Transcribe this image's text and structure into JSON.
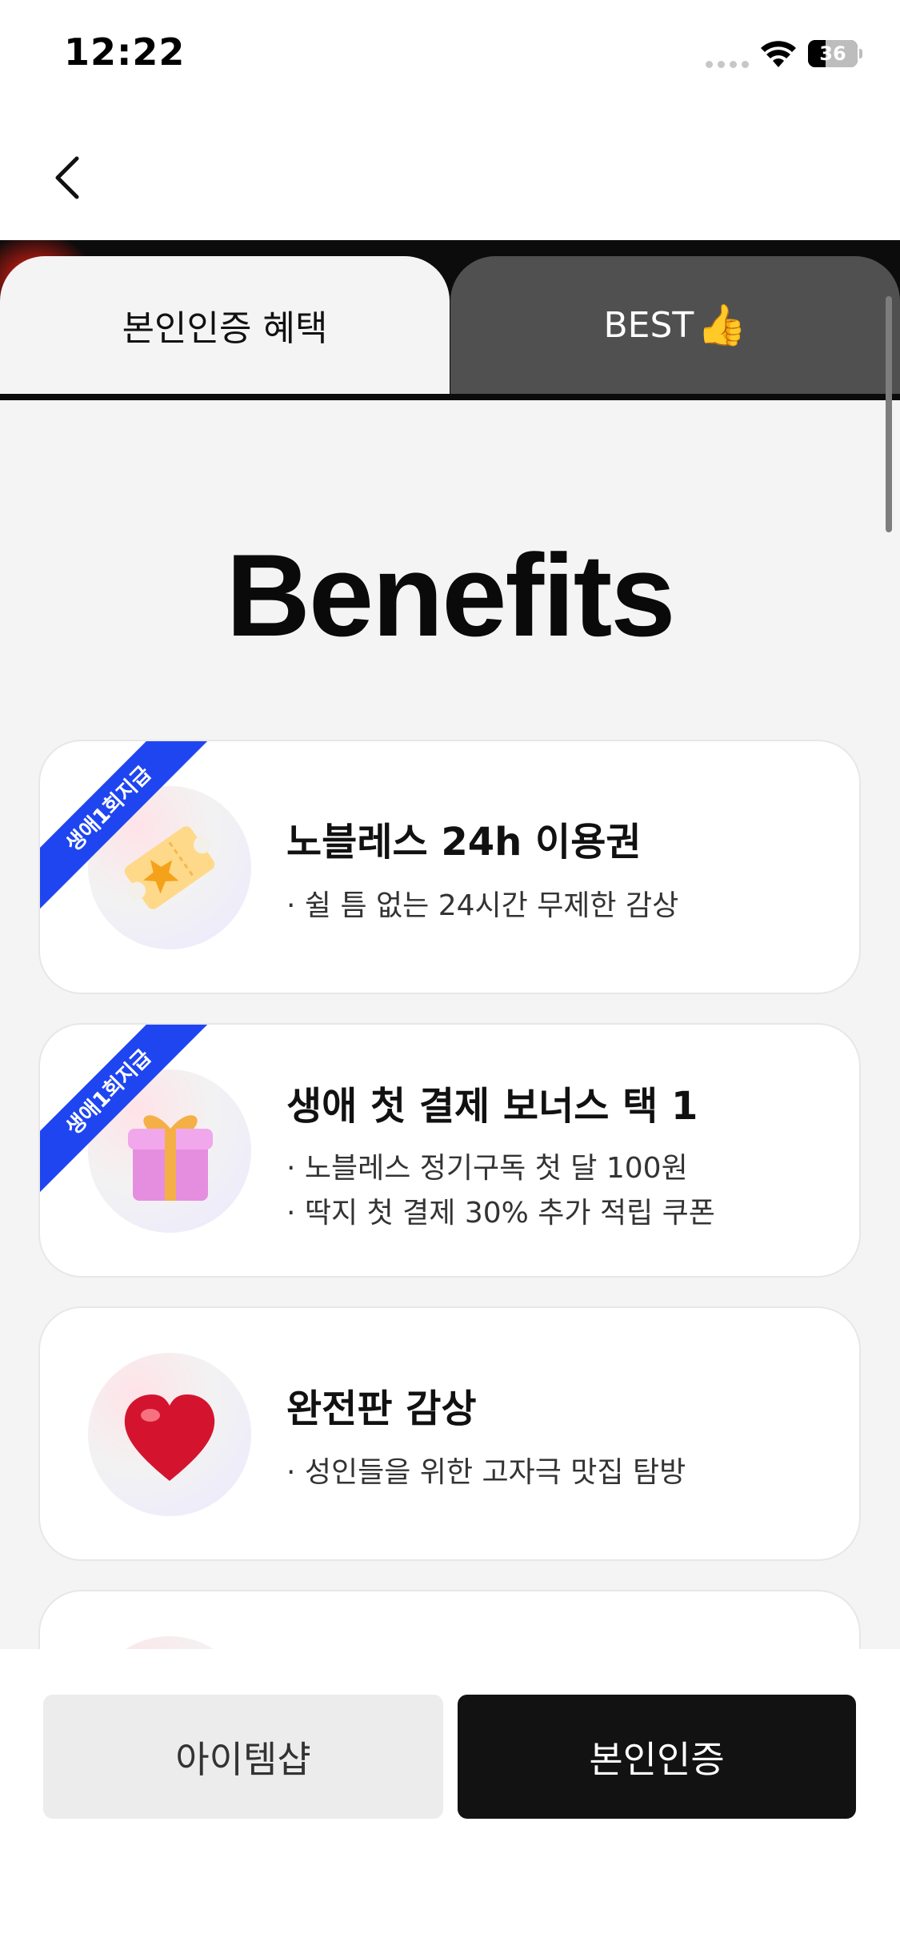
{
  "status_bar": {
    "time": "12:22",
    "battery": "36",
    "battery_level": 0.36
  },
  "tabs": [
    {
      "label": "본인인증 혜택",
      "active": true
    },
    {
      "label": "BEST",
      "emoji": "👍",
      "active": false
    }
  ],
  "page_title": "Benefits",
  "benefits": [
    {
      "badge": "생애1회지급",
      "icon": "ticket-star-icon",
      "title": "노블레스 24h 이용권",
      "desc": [
        "· 쉴 틈 없는 24시간 무제한 감상"
      ]
    },
    {
      "badge": "생애1회지급",
      "icon": "gift-box-icon",
      "title": "생애 첫 결제 보너스 택 1",
      "desc": [
        "· 노블레스 정기구독 첫 달 100원",
        "· 딱지 첫 결제 30% 추가 적립 쿠폰"
      ]
    },
    {
      "badge": "",
      "icon": "heart-icon",
      "title": "완전판 감상",
      "desc": [
        "· 성인들을 위한 고자극 맛집 탐방"
      ]
    }
  ],
  "bottom_buttons": {
    "shop": "아이템샵",
    "verify": "본인인증"
  },
  "colors": {
    "accent_ribbon": "#1f45f0",
    "primary_button": "#121212",
    "tab_inactive": "#505050"
  }
}
